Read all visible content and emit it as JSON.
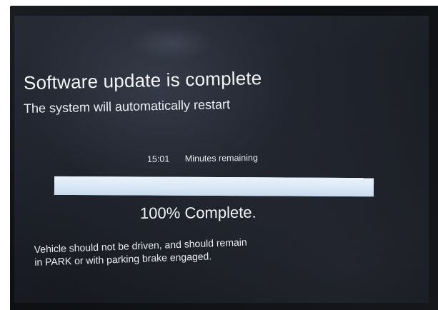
{
  "screen": {
    "title": "Software update is complete",
    "subtitle": "The system will automatically restart",
    "time_remaining": "15:01",
    "time_remaining_label": "Minutes remaining",
    "progress_fraction": 1.0,
    "progress_text": "100% Complete.",
    "warning_line1": "Vehicle should not be driven, and should remain",
    "warning_line2": "in PARK or with parking brake engaged."
  },
  "colors": {
    "progress_fill": "#dfeaf6",
    "progress_track": "#3a4150",
    "text": "#f2f3f6",
    "screen_background": "#1b1e25"
  }
}
